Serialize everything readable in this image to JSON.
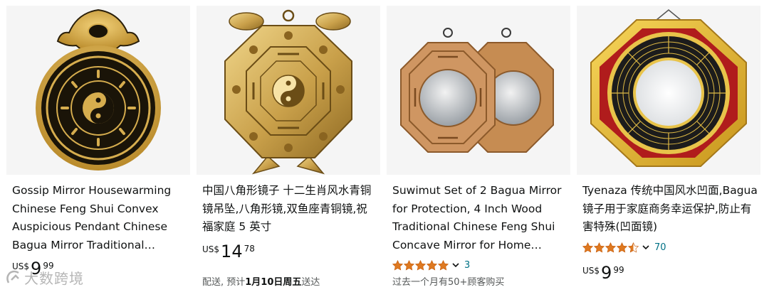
{
  "products": [
    {
      "title": "Gossip Mirror Housewarming Chinese Feng Shui Convex Auspicious Pendant Chinese Bagua Mirror Traditional…",
      "price_symbol": "US$",
      "price_whole": "9",
      "price_fraction": "99",
      "image": "octagonal-bagua-gold-black-pendant"
    },
    {
      "title": "中国八角形镜子 十二生肖风水青铜镜吊坠,八角形镜,双鱼座青铜镜,祝福家庭 5 英寸",
      "price_symbol": "US$",
      "price_whole": "14",
      "price_fraction": "78",
      "delivery_prefix": "配送, 预计",
      "delivery_date": "1月10日周五",
      "delivery_suffix": "送达",
      "image": "brass-zodiac-bagua-mirror"
    },
    {
      "title": "Suwimut Set of 2 Bagua Mirror for Protection, 4 Inch Wood Traditional Chinese Feng Shui Concave Mirror for Home…",
      "rating_value": 5.0,
      "rating_count": "3",
      "sales_note": "过去一个月有50+顾客购买",
      "image": "two-wooden-bagua-mirrors"
    },
    {
      "title": "Tyenaza 传统中国风水凹面,Bagua 镜子用于家庭商务幸运保护,防止有害特殊(凹面镜)",
      "rating_value": 4.5,
      "rating_count": "70",
      "price_symbol": "US$",
      "price_whole": "9",
      "price_fraction": "99",
      "image": "gold-frame-bagua-concave-mirror"
    }
  ],
  "colors": {
    "star": "#de7921",
    "link": "#007185",
    "text": "#0f1111",
    "muted": "#565959"
  },
  "watermark": {
    "text": "大数跨境",
    "icon": "watermark-logo-icon"
  }
}
